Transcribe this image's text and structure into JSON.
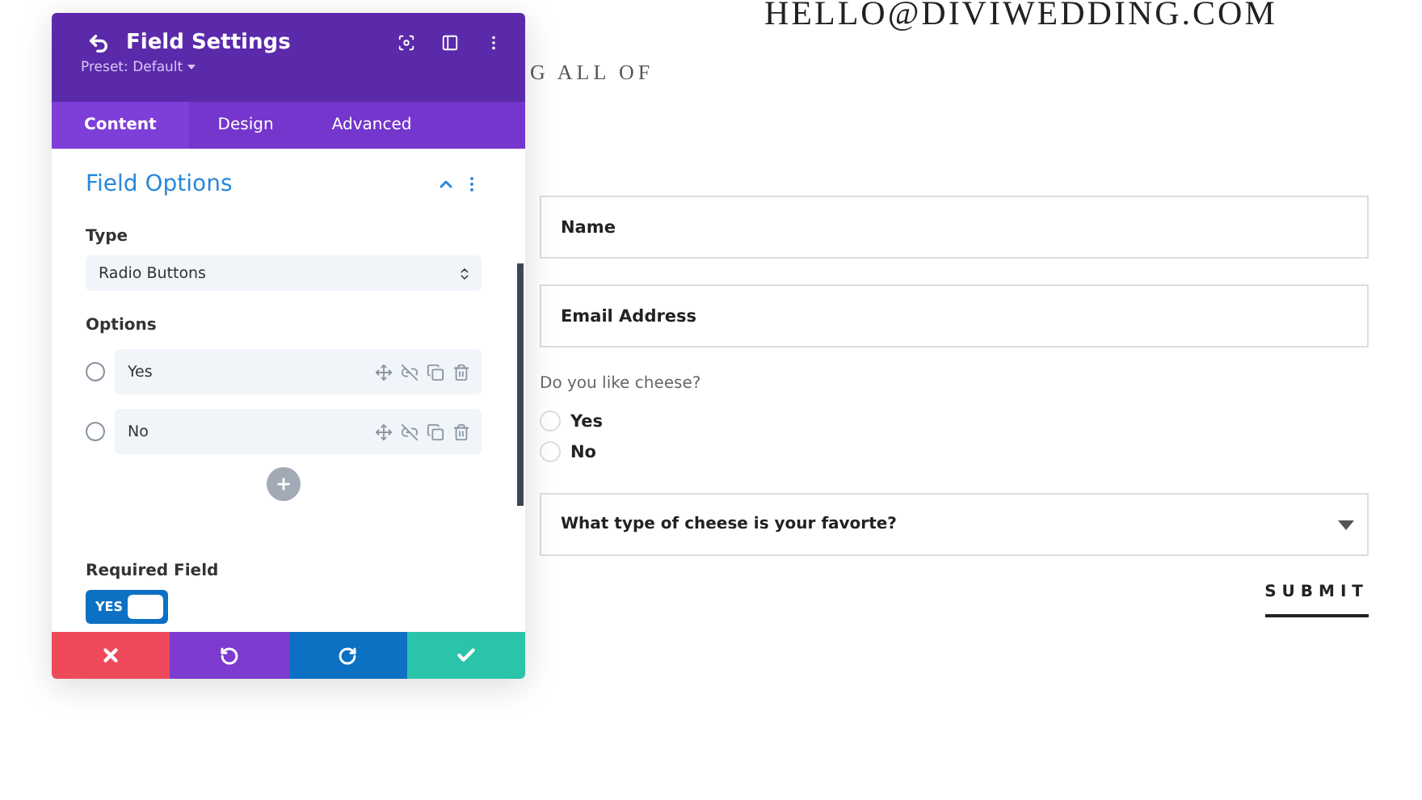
{
  "page": {
    "email": "HELLO@DIVIWEDDING.COM",
    "subtitle": "G ALL OF"
  },
  "form": {
    "fields": [
      {
        "placeholder": "Name"
      },
      {
        "placeholder": "Email Address"
      }
    ],
    "question": "Do you like cheese?",
    "choices": [
      {
        "label": "Yes",
        "selected": false
      },
      {
        "label": "No",
        "selected": false
      }
    ],
    "select": {
      "placeholder": "What type of cheese is your favorte?"
    },
    "submit": "SUBMIT"
  },
  "panel": {
    "title": "Field Settings",
    "preset": "Preset: Default",
    "tabs": [
      {
        "label": "Content",
        "selected": true
      },
      {
        "label": "Design",
        "selected": false
      },
      {
        "label": "Advanced",
        "selected": false
      }
    ],
    "section": {
      "title": "Field Options",
      "expanded": true
    },
    "type_label": "Type",
    "type_value": "Radio Buttons",
    "options_label": "Options",
    "options": [
      {
        "label": "Yes",
        "selected": false
      },
      {
        "label": "No",
        "selected": false
      }
    ],
    "required_label": "Required Field",
    "required": {
      "on": true,
      "label": "YES"
    }
  }
}
